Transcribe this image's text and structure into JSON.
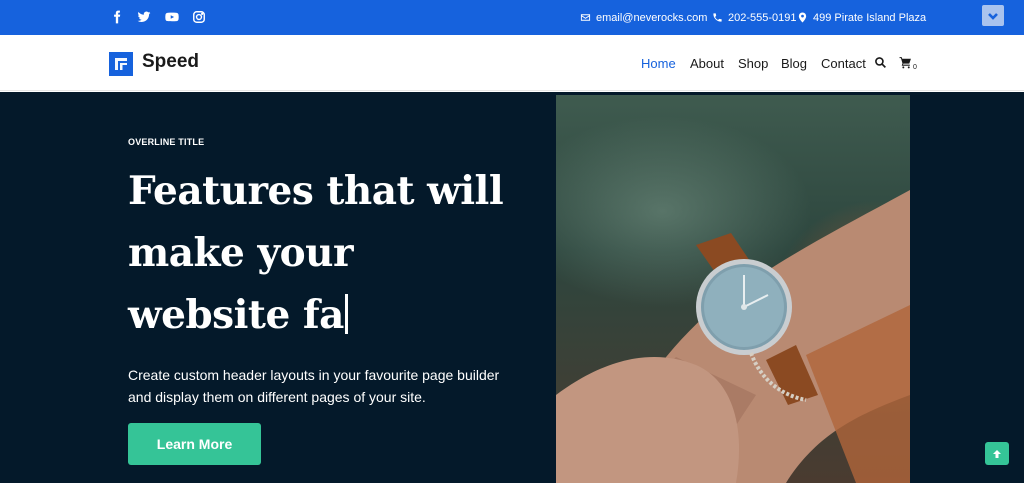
{
  "topbar": {
    "social": [
      "facebook-icon",
      "twitter-icon",
      "youtube-icon",
      "instagram-icon"
    ],
    "email": "email@neverocks.com",
    "phone": "202-555-0191",
    "address": "499 Pirate Island Plaza"
  },
  "header": {
    "logo_text": "Speed",
    "nav": [
      "Home",
      "About",
      "Shop",
      "Blog",
      "Contact"
    ],
    "cart_count": "0"
  },
  "hero": {
    "overline": "OVERLINE TITLE",
    "headline_lines": [
      "Features that will",
      "make your",
      "website fa"
    ],
    "description": "Create custom header layouts in your favourite page builder and display them on different pages of your site.",
    "button_label": "Learn More"
  },
  "colors": {
    "primary": "#1662dd",
    "accent": "#35c497",
    "hero_bg": "#04192a"
  }
}
